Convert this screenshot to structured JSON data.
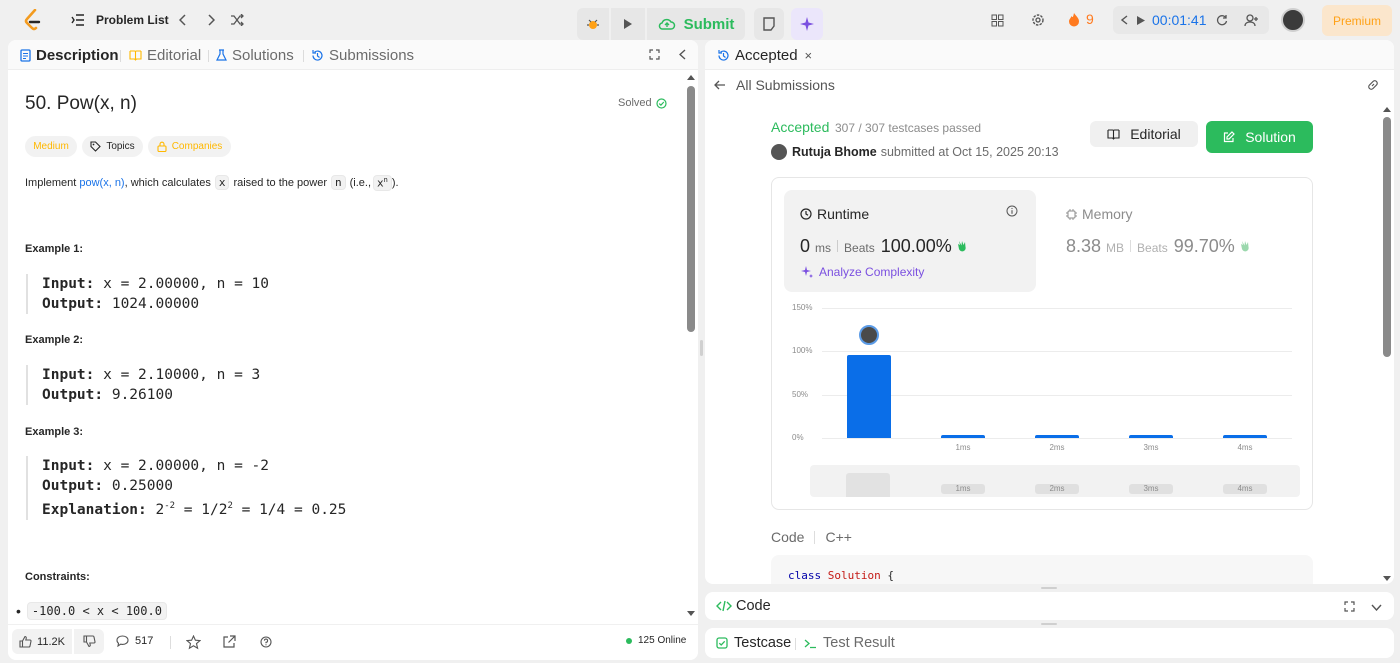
{
  "nav": {
    "problem_list": "Problem List",
    "submit_label": "Submit",
    "streak_count": "9",
    "timer": "00:01:41",
    "premium_label": "Premium"
  },
  "left": {
    "tabs": [
      "Description",
      "Editorial",
      "Solutions",
      "Submissions"
    ],
    "title": "50. Pow(x, n)",
    "solved_label": "Solved",
    "tags": [
      "Medium",
      "Topics",
      "Companies"
    ],
    "statement": {
      "pre": "Implement ",
      "link": "pow(x, n)",
      "mid": ", which calculates ",
      "var_x": "x",
      "mid2": " raised to the power ",
      "var_n": "n",
      "mid3": " (i.e., ",
      "xn_base": "x",
      "xn_exp": "n",
      "post": ")."
    },
    "examples": [
      {
        "title": "Example 1:",
        "input": "x = 2.00000, n = 10",
        "output": "1024.00000"
      },
      {
        "title": "Example 2:",
        "input": "x = 2.10000, n = 3",
        "output": "9.26100"
      },
      {
        "title": "Example 3:",
        "input": "x = 2.00000, n = -2",
        "output": "0.25000",
        "explanation": {
          "base1": "2",
          "exp1": "-2",
          "mid": " = 1/2",
          "exp2": "2",
          "end": " = 1/4 = 0.25"
        }
      }
    ],
    "labels": {
      "input": "Input:",
      "output": "Output:",
      "explanation": "Explanation:"
    },
    "constraints_title": "Constraints:",
    "constraint_1": "-100.0 < x < 100.0",
    "footer": {
      "likes": "11.2K",
      "comments": "517",
      "online": "125 Online"
    }
  },
  "right": {
    "tab_label": "Accepted",
    "back_label": "All Submissions",
    "status": "Accepted",
    "testcases": "307 / 307 testcases passed",
    "user": "Rutuja Bhome",
    "submitted_at": "submitted at Oct 15, 2025 20:13",
    "editorial_btn": "Editorial",
    "solution_btn": "Solution",
    "runtime": {
      "label": "Runtime",
      "value": "0",
      "unit": "ms",
      "beats_label": "Beats",
      "beats": "100.00%"
    },
    "analyze_label": "Analyze Complexity",
    "memory": {
      "label": "Memory",
      "value": "8.38",
      "unit": "MB",
      "beats_label": "Beats",
      "beats": "99.70%"
    },
    "code_label": "Code",
    "language": "C++",
    "code_kw": "class",
    "code_name": "Solution",
    "code_brace": "{"
  },
  "bottom": {
    "code_panel": "Code",
    "testcase_tab": "Testcase",
    "result_tab": "Test Result"
  },
  "chart_data": {
    "type": "bar",
    "categories": [
      "0ms",
      "1ms",
      "2ms",
      "3ms",
      "4ms"
    ],
    "x_tick_labels": [
      "",
      "1ms",
      "2ms",
      "3ms",
      "4ms"
    ],
    "values": [
      96,
      3,
      3,
      3,
      3
    ],
    "y_ticks": [
      "150%",
      "100%",
      "50%",
      "0%"
    ],
    "ylim": [
      0,
      150
    ],
    "highlighted_category": "0ms",
    "brush_labels": [
      "1ms",
      "2ms",
      "3ms",
      "4ms"
    ]
  },
  "colors": {
    "accent_green": "#2cbb5d",
    "blue": "#0a6ee8",
    "medium": "#ffb800",
    "orange": "#ffa116"
  }
}
